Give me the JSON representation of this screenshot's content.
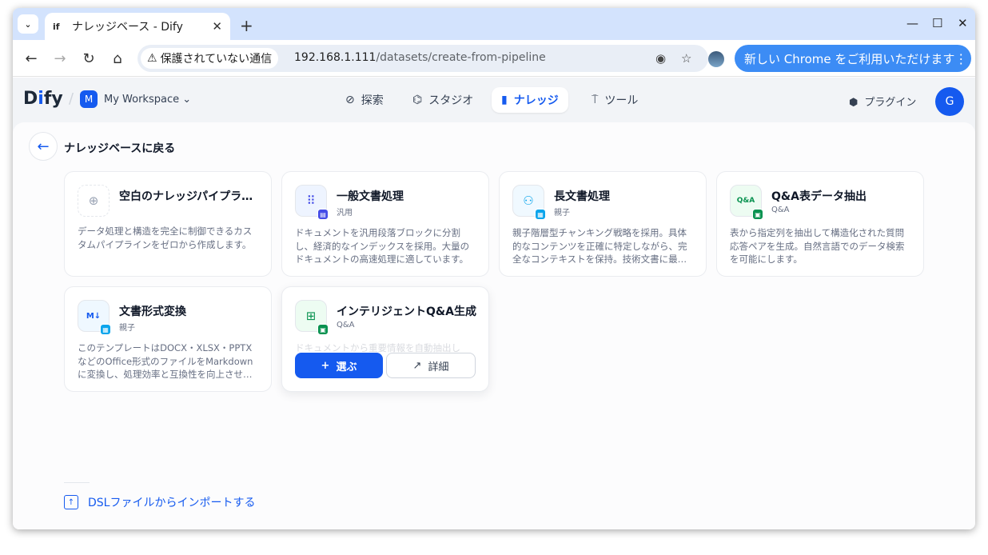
{
  "browser": {
    "tab_title": "ナレッジベース - Dify",
    "tab_favicon": "if",
    "security_label": "保護されていない通信",
    "url_host": "192.168.1.111",
    "url_path": "/datasets/create-from-pipeline",
    "promo_label": "新しい Chrome をご利用いただけます"
  },
  "header": {
    "logo_prefix": "D",
    "logo_mid": "i",
    "logo_suffix": "fy",
    "workspace_initial": "M",
    "workspace_name": "My Workspace",
    "nav": [
      {
        "label": "探索",
        "icon": "compass-icon"
      },
      {
        "label": "スタジオ",
        "icon": "robot-icon"
      },
      {
        "label": "ナレッジ",
        "icon": "book-icon"
      },
      {
        "label": "ツール",
        "icon": "hammer-icon"
      }
    ],
    "plugin_label": "プラグイン",
    "avatar_initial": "G"
  },
  "page": {
    "back_label": "ナレッジベースに戻る",
    "import_label": "DSLファイルからインポートする"
  },
  "templates": [
    {
      "title": "空白のナレッジパイプライン",
      "tag": "",
      "desc": "データ処理と構造を完全に制御できるカスタムパイプラインをゼロから作成します。",
      "icon": "plus-icon",
      "color": "#98a2b3"
    },
    {
      "title": "一般文書処理",
      "tag": "汎用",
      "desc": "ドキュメントを汎用段落ブロックに分割し、経済的なインデックスを採用。大量のドキュメントの高速処理に適しています。",
      "icon": "grid-icon",
      "color": "#444ce7"
    },
    {
      "title": "長文書処理",
      "tag": "親子",
      "desc": "親子階層型チャンキング戦略を採用。具体的なコンテンツを正確に特定しながら、完全なコンテキストを保持。技術文書に最適です。",
      "icon": "hierarchy-icon",
      "color": "#0ba5ec"
    },
    {
      "title": "Q&A表データ抽出",
      "tag": "Q&A",
      "desc": "表から指定列を抽出して構造化された質問応答ペアを生成。自然言語でのデータ検索を可能にします。",
      "icon": "table-icon",
      "color": "#099250"
    },
    {
      "title": "文書形式変換",
      "tag": "親子",
      "desc": "このテンプレートはDOCX・XLSX・PPTXなどのOffice形式のファイルをMarkdownに変換し、処理効率と互換性を向上させます。",
      "icon": "markdown-icon",
      "color": "#155aef"
    },
    {
      "title": "インテリジェントQ&A生成",
      "tag": "Q&A",
      "desc": "ドキュメントから重要情報を自動抽出し",
      "icon": "chat-plus-icon",
      "color": "#099250"
    }
  ],
  "actions": {
    "select_label": "選ぶ",
    "detail_label": "詳細"
  }
}
